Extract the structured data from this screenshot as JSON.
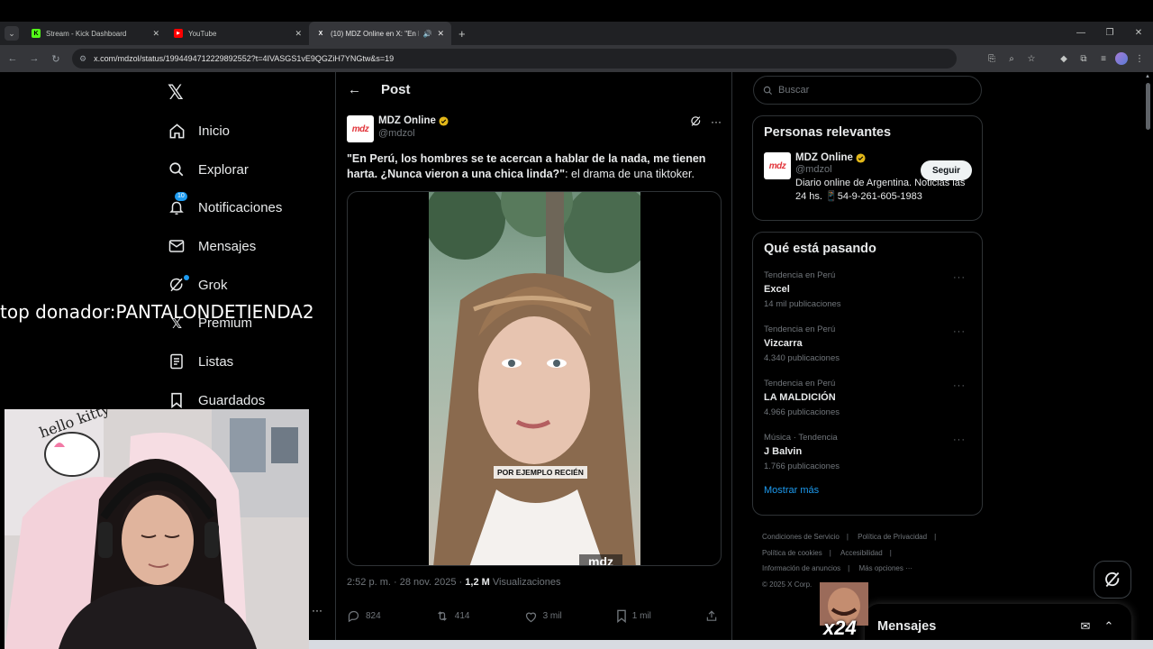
{
  "browser": {
    "tabs": [
      {
        "title": "Stream - Kick Dashboard",
        "favicon_color": "#53fc18",
        "favicon_letter": "K"
      },
      {
        "title": "YouTube",
        "favicon_color": "#ff0000",
        "favicon_letter": "▶"
      },
      {
        "title": "(10) MDZ Online en X: \"En P",
        "favicon_color": "#000000",
        "favicon_letter": "X",
        "active": true
      }
    ],
    "url": "x.com/mdzol/status/1994494712229892552?t=4IVASGS1vE9QGZiH7YNGtw&s=19"
  },
  "nav": {
    "items": [
      {
        "label": "Inicio",
        "icon": "home-icon"
      },
      {
        "label": "Explorar",
        "icon": "search-icon"
      },
      {
        "label": "Notificaciones",
        "icon": "bell-icon",
        "badge": "10"
      },
      {
        "label": "Mensajes",
        "icon": "mail-icon"
      },
      {
        "label": "Grok",
        "icon": "grok-icon"
      },
      {
        "label": "Premium",
        "icon": "x-premium-icon"
      },
      {
        "label": "Listas",
        "icon": "list-icon"
      },
      {
        "label": "Guardados",
        "icon": "bookmark-icon"
      }
    ]
  },
  "overlay": {
    "text": "top donador:PANTALONDETIENDA2"
  },
  "post": {
    "header_title": "Post",
    "author_name": "MDZ Online",
    "author_handle": "@mdzol",
    "avatar_text": "mdz",
    "text_bold": "\"En Perú, los hombres se te acercan a hablar de la nada, me tienen harta. ¿Nunca vieron a una chica linda?\"",
    "text_rest": ": el drama de una tiktoker.",
    "video_caption": "POR EJEMPLO RECIÉN",
    "video_watermark": "mdz",
    "time": "2:52 p. m.",
    "date": "28 nov. 2025",
    "views_count": "1,2 M",
    "views_label": "Visualizaciones",
    "replies": "824",
    "reposts": "414",
    "likes": "3 mil",
    "bookmarks": "1 mil"
  },
  "sidebar": {
    "search_placeholder": "Buscar",
    "relevant_title": "Personas relevantes",
    "relevant_user": {
      "name": "MDZ Online",
      "handle": "@mdzol",
      "bio": "Diario online de Argentina. Noticias las 24 hs. 📱54-9-261-605-1983",
      "follow_label": "Seguir"
    },
    "trends_title": "Qué está pasando",
    "trends": [
      {
        "context": "Tendencia en Perú",
        "topic": "Excel",
        "count": "14 mil publicaciones"
      },
      {
        "context": "Tendencia en Perú",
        "topic": "Vizcarra",
        "count": "4.340 publicaciones"
      },
      {
        "context": "Tendencia en Perú",
        "topic": "LA MALDICIÓN",
        "count": "4.966 publicaciones"
      },
      {
        "context": "Música · Tendencia",
        "topic": "J Balvin",
        "count": "1.766 publicaciones"
      }
    ],
    "show_more": "Mostrar más",
    "footer_links": [
      "Condiciones de Servicio",
      "Política de Privacidad",
      "Política de cookies",
      "Accesibilidad",
      "Información de anuncios",
      "Más opciones ···"
    ],
    "copyright": "© 2025 X Corp."
  },
  "messages": {
    "label": "Mensajes"
  },
  "sticker_text": "x24",
  "colors": {
    "accent": "#1d9bf0",
    "background": "#000000",
    "border": "#2f3336",
    "muted": "#71767b"
  }
}
